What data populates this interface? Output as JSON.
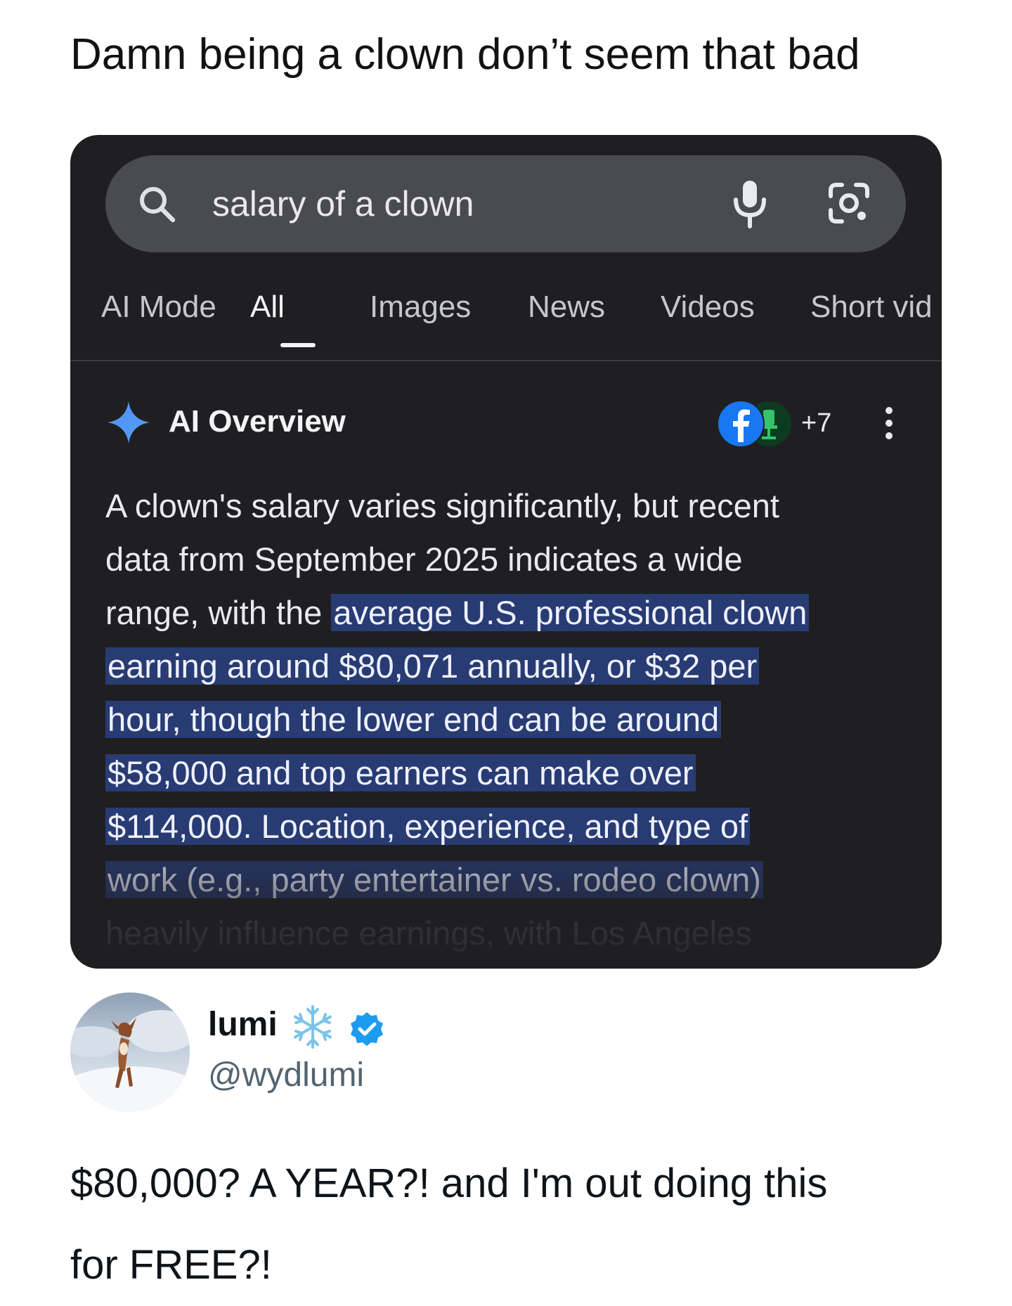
{
  "caption": "Damn being a clown don’t seem that bad",
  "search": {
    "query": "salary of a clown",
    "icons": [
      "search-icon",
      "mic-icon",
      "lens-icon"
    ]
  },
  "tabs": [
    {
      "label": "AI Mode",
      "active": false
    },
    {
      "label": "All",
      "active": true
    },
    {
      "label": "Images",
      "active": false
    },
    {
      "label": "News",
      "active": false
    },
    {
      "label": "Videos",
      "active": false
    },
    {
      "label": "Short vid",
      "active": false
    }
  ],
  "ai_overview": {
    "title": "AI Overview",
    "source_count": "+7",
    "lines": [
      {
        "plain": "A clown's salary varies significantly, but recent",
        "highlight": ""
      },
      {
        "plain": "data from September 2025 indicates a wide",
        "highlight": ""
      },
      {
        "plain": "range, with the ",
        "highlight": "average U.S. professional clown"
      },
      {
        "plain": "",
        "highlight": "earning around $80,071 annually, or $32 per"
      },
      {
        "plain": "",
        "highlight": "hour, though the lower end can be around"
      },
      {
        "plain": "",
        "highlight": "$58,000 and top earners can make over"
      },
      {
        "plain": "",
        "highlight": "$114,000. Location, experience, and type of"
      },
      {
        "plain": "",
        "highlight": "work (e.g., party entertainer vs. rodeo clown)"
      },
      {
        "plain": "heavily influence earnings, with Los Angeles",
        "highlight": ""
      }
    ]
  },
  "tweet": {
    "name": "lumi",
    "handle": "@wydlumi",
    "text_line1": "$80,000? A YEAR?! and I'm out doing this",
    "text_line2": "for FREE?!"
  },
  "colors": {
    "card_bg": "#1f1f21",
    "searchbar_bg": "#4a4b4f",
    "highlight_bg": "#283b73",
    "verified_blue": "#1d9bf0",
    "gemini_blue": "#4f8ef7"
  }
}
